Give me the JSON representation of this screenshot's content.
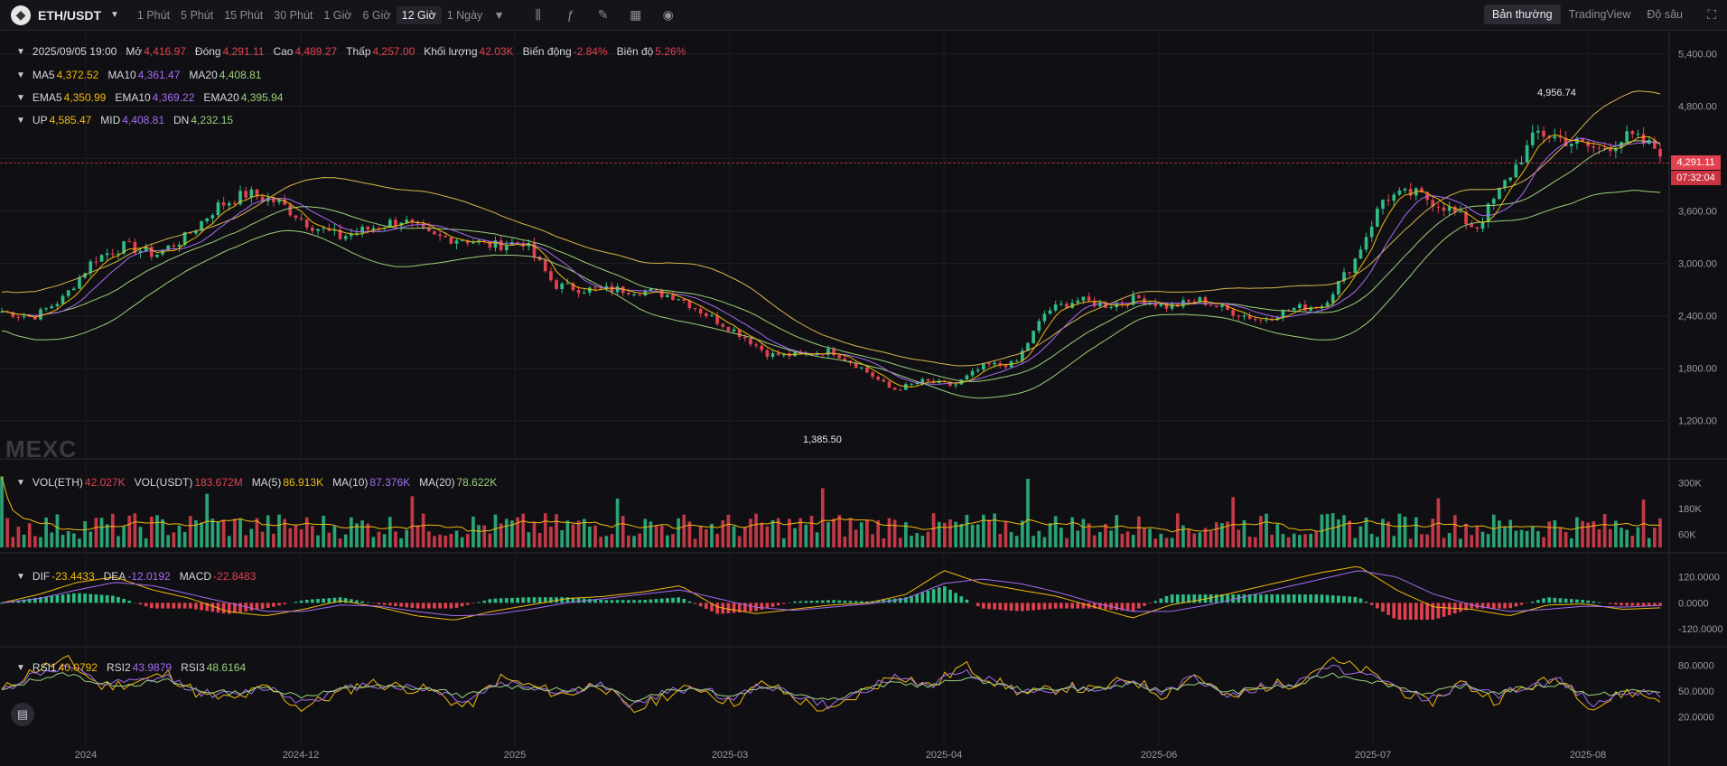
{
  "header": {
    "symbol": "ETH/USDT",
    "intervals": [
      "1 Phút",
      "5 Phút",
      "15 Phút",
      "30 Phút",
      "1 Giờ",
      "6 Giờ",
      "12 Giờ",
      "1 Ngày"
    ],
    "active_interval": "12 Giờ",
    "modes": [
      "Bản thường",
      "TradingView",
      "Độ sâu"
    ],
    "active_mode": "Bản thường"
  },
  "ohlc": {
    "date": "2025/09/05 19:00",
    "open_label": "Mở",
    "open": "4,416.97",
    "close_label": "Đóng",
    "close": "4,291.11",
    "high_label": "Cao",
    "high": "4,489.27",
    "low_label": "Thấp",
    "low": "4,257.00",
    "vol_label": "Khối lượng",
    "vol": "42.03K",
    "change_label": "Biến động",
    "change": "-2.84%",
    "amp_label": "Biên độ",
    "amp": "5.26%"
  },
  "ma": {
    "ma5": "4,372.52",
    "ma10": "4,361.47",
    "ma20": "4,408.81"
  },
  "ema": {
    "ema5": "4,350.99",
    "ema10": "4,369.22",
    "ema20": "4,395.94"
  },
  "boll": {
    "up": "4,585.47",
    "mid": "4,408.81",
    "dn": "4,232.15"
  },
  "vol_legend": {
    "vol_eth_label": "VOL(ETH)",
    "vol_eth": "42.027K",
    "vol_usdt_label": "VOL(USDT)",
    "vol_usdt": "183.672M",
    "ma5": "86.913K",
    "ma10": "87.376K",
    "ma20": "78.622K"
  },
  "macd_legend": {
    "dif": "-23.4433",
    "dea": "-12.0192",
    "macd": "-22.8483"
  },
  "rsi_legend": {
    "rsi1": "40.0792",
    "rsi2": "43.9879",
    "rsi3": "48.6164"
  },
  "price_tag": {
    "price": "4,291.11",
    "countdown": "07:32:04"
  },
  "watermark": "MEXC",
  "colors": {
    "up": "#2ebd85",
    "down": "#e2414f",
    "ma5": "#f0b90b",
    "ma10": "#a66bf2",
    "ma20": "#9bd07a",
    "boll": "#d9b44a",
    "white": "#e8e8ea"
  },
  "chart_data": [
    {
      "type": "line",
      "title": "ETH/USDT 12 Giờ",
      "xlabel": "",
      "ylabel": "",
      "x_ticks": [
        "2024",
        "2024-12",
        "2025",
        "2025-03",
        "2025-04",
        "2025-06",
        "2025-07",
        "2025-08"
      ],
      "y_ticks": [
        "5,400.00",
        "4,800.00",
        "4,200.00",
        "3,600.00",
        "3,000.00",
        "2,400.00",
        "1,800.00",
        "1,200.00"
      ],
      "ylim": [
        1000,
        5600
      ],
      "annotations": {
        "high": "4,956.74",
        "low": "1,385.50"
      },
      "series": [
        {
          "name": "close",
          "values": [
            2450,
            2380,
            2600,
            3050,
            3200,
            3100,
            3300,
            3650,
            3800,
            3700,
            3450,
            3300,
            3400,
            3500,
            3300,
            3280,
            3200,
            3250,
            2750,
            2700,
            2700,
            2680,
            2620,
            2400,
            2200,
            1950,
            1950,
            2000,
            1800,
            1550,
            1650,
            1600,
            1830,
            1850,
            2450,
            2580,
            2520,
            2600,
            2500,
            2580,
            2450,
            2350,
            2480,
            2520,
            3000,
            3750,
            3800,
            3650,
            3400,
            3950,
            4500,
            4400,
            4300,
            4450,
            4291
          ]
        }
      ]
    },
    {
      "type": "bar",
      "title": "VOL(ETH)",
      "y_ticks": [
        "300K",
        "180K",
        "60K"
      ],
      "ylim": [
        0,
        360000
      ]
    },
    {
      "type": "line",
      "title": "MACD",
      "y_ticks": [
        "120.0000",
        "0.0000",
        "-120.0000"
      ],
      "ylim": [
        -170,
        190
      ],
      "series": [
        {
          "name": "DIF",
          "values": [
            0,
            40,
            95,
            120,
            60,
            20,
            -40,
            -60,
            -30,
            10,
            -20,
            -60,
            -80,
            -40,
            -10,
            20,
            30,
            50,
            80,
            -20,
            -50,
            -30,
            -10,
            0,
            40,
            150,
            90,
            60,
            30,
            -20,
            -70,
            -10,
            20,
            60,
            100,
            140,
            170,
            60,
            -20,
            -30,
            -60,
            -10,
            -5,
            -30,
            -23
          ]
        },
        {
          "name": "DEA",
          "values": [
            0,
            20,
            60,
            95,
            80,
            40,
            0,
            -40,
            -40,
            -10,
            -15,
            -40,
            -60,
            -55,
            -30,
            0,
            20,
            40,
            60,
            20,
            -20,
            -35,
            -20,
            -5,
            20,
            90,
            110,
            90,
            50,
            0,
            -40,
            -40,
            -10,
            30,
            70,
            110,
            150,
            120,
            40,
            -10,
            -40,
            -30,
            -15,
            -20,
            -12
          ]
        }
      ]
    },
    {
      "type": "line",
      "title": "RSI",
      "y_ticks": [
        "80.0000",
        "50.0000",
        "20.0000"
      ],
      "ylim": [
        5,
        95
      ],
      "series": [
        {
          "name": "RSI1",
          "values": [
            50,
            75,
            85,
            55,
            60,
            70,
            45,
            40,
            55,
            30,
            45,
            60,
            55,
            50,
            30,
            65,
            55,
            45,
            60,
            25,
            45,
            55,
            35,
            60,
            40,
            25,
            50,
            70,
            55,
            80,
            60,
            45,
            55,
            50,
            65,
            45,
            70,
            40,
            55,
            60,
            85,
            75,
            55,
            35,
            60,
            40,
            55,
            65,
            30,
            50,
            40
          ]
        },
        {
          "name": "RSI2",
          "values": [
            50,
            70,
            78,
            58,
            60,
            66,
            48,
            45,
            55,
            38,
            48,
            58,
            55,
            52,
            38,
            60,
            55,
            48,
            58,
            33,
            48,
            55,
            40,
            58,
            44,
            32,
            52,
            66,
            56,
            74,
            60,
            48,
            55,
            52,
            62,
            48,
            66,
            44,
            55,
            58,
            78,
            70,
            56,
            40,
            58,
            44,
            55,
            62,
            36,
            50,
            44
          ]
        },
        {
          "name": "RSI3",
          "values": [
            50,
            64,
            70,
            58,
            58,
            62,
            50,
            48,
            54,
            44,
            50,
            56,
            54,
            52,
            44,
            56,
            54,
            50,
            56,
            40,
            50,
            54,
            44,
            56,
            47,
            40,
            52,
            60,
            55,
            66,
            58,
            50,
            54,
            52,
            58,
            50,
            60,
            48,
            54,
            56,
            70,
            64,
            56,
            46,
            56,
            48,
            54,
            58,
            44,
            50,
            49
          ]
        }
      ]
    }
  ]
}
